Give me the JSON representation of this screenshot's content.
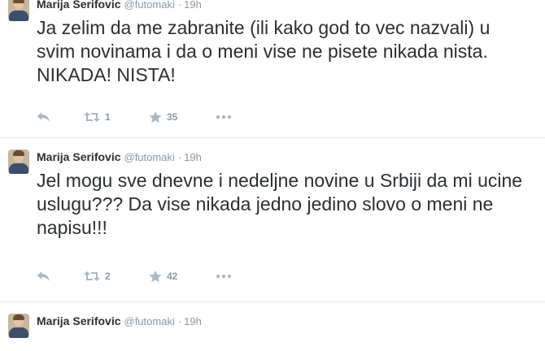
{
  "tweets": [
    {
      "author": {
        "fullname": "Marija Serifovic",
        "username": "@futomaki"
      },
      "time": "19h",
      "text": "Ja zelim da me zabranite (ili kako god to vec nazvali) u svim novinama i da o meni vise ne pisete nikada nista. NIKADA! NISTA!",
      "retweets": "1",
      "favorites": "35"
    },
    {
      "author": {
        "fullname": "Marija Serifovic",
        "username": "@futomaki"
      },
      "time": "19h",
      "text": "Jel mogu sve dnevne i nedeljne novine u Srbiji da mi ucine uslugu??? Da vise nikada jedno jedino slovo o meni ne napisu!!!",
      "retweets": "2",
      "favorites": "42"
    },
    {
      "author": {
        "fullname": "Marija Serifovic",
        "username": "@futomaki"
      },
      "time": "19h"
    }
  ],
  "separator": "·",
  "icons": {
    "reply": "reply-icon",
    "retweet": "retweet-icon",
    "favorite": "star-icon",
    "more": "more-dots-icon"
  },
  "colors": {
    "text": "#292f33",
    "meta": "#8899a6",
    "action_icon": "#aab8c2",
    "divider": "#e1e8ed"
  }
}
